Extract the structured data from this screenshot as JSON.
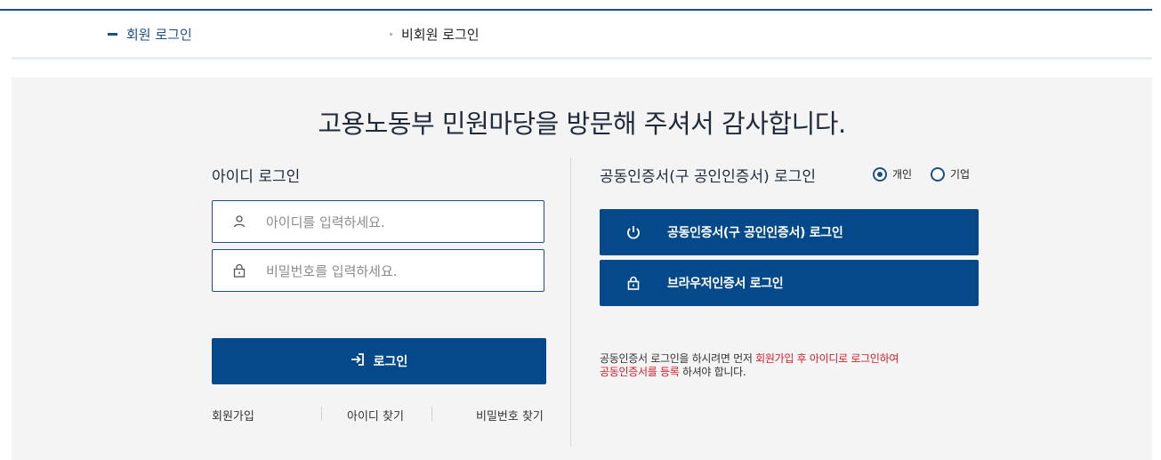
{
  "tabs": {
    "member_login": "회원 로그인",
    "guest_login": "비회원 로그인"
  },
  "headline": "고용노동부 민원마당을 방문해 주셔서 감사합니다.",
  "id_login": {
    "title": "아이디 로그인",
    "id_placeholder": "아이디를 입력하세요.",
    "pw_placeholder": "비밀번호를 입력하세요.",
    "login_button": "로그인",
    "links": {
      "signup": "회원가입",
      "find_id": "아이디 찾기",
      "find_pw": "비밀번호 찾기"
    }
  },
  "cert_login": {
    "title": "공동인증서(구 공인인증서) 로그인",
    "radio_personal": "개인",
    "radio_business": "기업",
    "selected": "개인",
    "cert_button": "공동인증서(구 공인인증서) 로그인",
    "browser_button": "브라우저인증서 로그인",
    "notice_1": "공동인증서 로그인을 하시려면 먼저 ",
    "notice_hl_1": "회원가입 후 아이디로 로그인하여",
    "notice_hl_2": "공동인증서를 등록",
    "notice_2": " 하셔야 합니다."
  },
  "icons": {
    "user": "user-icon",
    "lock": "lock-icon",
    "login": "login-arrow-icon",
    "power": "power-icon"
  },
  "colors": {
    "brand": "#05498a",
    "highlight": "#d11f2a",
    "panel_bg": "#f4f4f4"
  }
}
